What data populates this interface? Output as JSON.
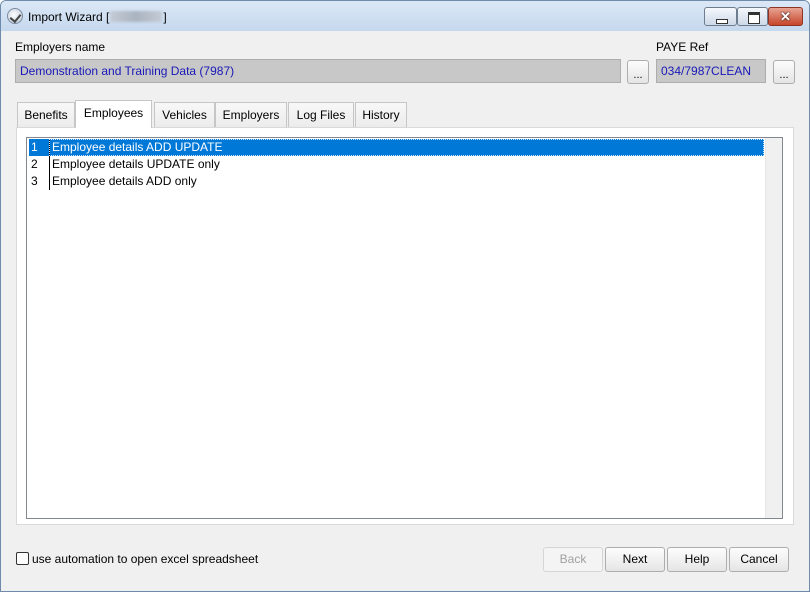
{
  "window": {
    "title_prefix": "Import Wizard [",
    "title_suffix": "]",
    "close_glyph": "✕"
  },
  "employer": {
    "label": "Employers name",
    "value": "Demonstration and Training Data (7987)",
    "browse_label": "..."
  },
  "paye": {
    "label": "PAYE Ref",
    "value": "034/7987CLEAN",
    "browse_label": "..."
  },
  "tabs": [
    {
      "label": "Benefits",
      "active": false
    },
    {
      "label": "Employees",
      "active": true
    },
    {
      "label": "Vehicles",
      "active": false
    },
    {
      "label": "Employers",
      "active": false
    },
    {
      "label": "Log Files",
      "active": false
    },
    {
      "label": "History",
      "active": false
    }
  ],
  "list": {
    "items": [
      {
        "num": "1",
        "text": "Employee details ADD UPDATE",
        "selected": true
      },
      {
        "num": "2",
        "text": "Employee details UPDATE only",
        "selected": false
      },
      {
        "num": "3",
        "text": "Employee details ADD only",
        "selected": false
      }
    ]
  },
  "options": {
    "automation_label": "use automation to open excel spreadsheet",
    "automation_checked": false
  },
  "buttons": {
    "back": "Back",
    "next": "Next",
    "help": "Help",
    "cancel": "Cancel"
  },
  "colors": {
    "accent_selection": "#0078d7",
    "field_text": "#1818b8"
  }
}
